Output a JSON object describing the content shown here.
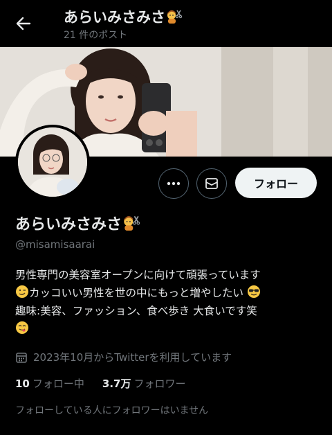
{
  "header": {
    "title": "あらいみさみさ",
    "post_count": "21 件のポスト"
  },
  "profile": {
    "name": "あらいみさみさ",
    "handle": "@misamisaarai",
    "bio_lines": [
      "男性専門の美容室オープンに向けて頑張っています",
      "カッコいい男性を世の中にもっと増やしたい",
      "趣味:美容、ファッション、食べ歩き 大食いです笑"
    ],
    "joined": "2023年10月からTwitterを利用しています",
    "following_count": "10",
    "following_label": "フォロー中",
    "followers_count": "3.7万",
    "followers_label": "フォロワー",
    "followers_you_know": "フォローしている人にフォロワーはいません"
  },
  "actions": {
    "follow_label": "フォロー"
  },
  "icons": {
    "back": "arrow-left-icon",
    "more": "more-dots-icon",
    "message": "mail-icon",
    "calendar": "calendar-icon",
    "hairdresser": "hairdresser-emoji",
    "wink": "wink-emoji",
    "cool": "sunglasses-emoji",
    "yum": "yum-emoji"
  },
  "colors": {
    "background": "#000000",
    "text": "#e7e9ea",
    "secondary": "#71767b",
    "follow_button_bg": "#eff3f4"
  }
}
